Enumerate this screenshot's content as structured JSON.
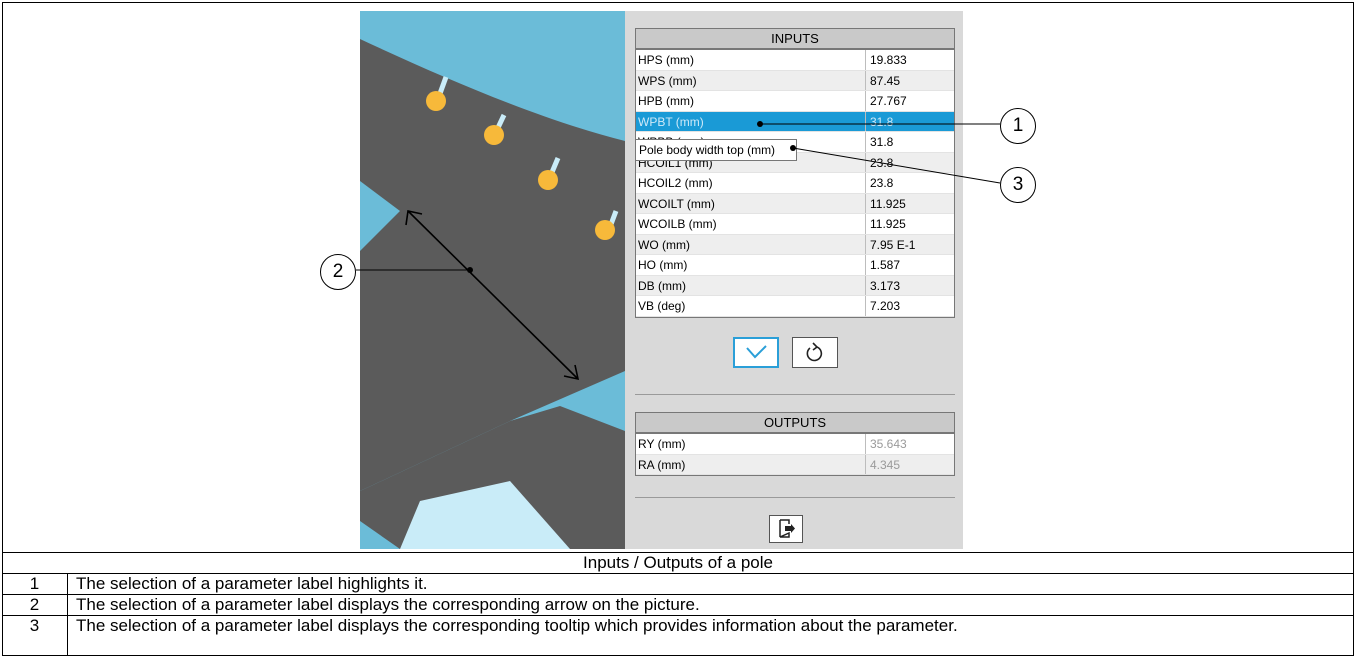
{
  "inputs": {
    "header": "INPUTS",
    "rows": [
      {
        "label": "HPS (mm)",
        "value": "19.833"
      },
      {
        "label": "WPS (mm)",
        "value": "87.45"
      },
      {
        "label": "HPB (mm)",
        "value": "27.767"
      },
      {
        "label": "WPBT (mm)",
        "value": "31.8"
      },
      {
        "label": "WPBB (mm)",
        "value": "31.8"
      },
      {
        "label": "HCOIL1 (mm)",
        "value": "23.8"
      },
      {
        "label": "HCOIL2 (mm)",
        "value": "23.8"
      },
      {
        "label": "WCOILT (mm)",
        "value": "11.925"
      },
      {
        "label": "WCOILB (mm)",
        "value": "11.925"
      },
      {
        "label": "WO (mm)",
        "value": "7.95 E-1"
      },
      {
        "label": "HO (mm)",
        "value": "1.587"
      },
      {
        "label": "DB (mm)",
        "value": "3.173"
      },
      {
        "label": "VB (deg)",
        "value": "7.203"
      }
    ],
    "selected_index": 3
  },
  "tooltip": "Pole body width top (mm)",
  "outputs": {
    "header": "OUTPUTS",
    "rows": [
      {
        "label": "RY (mm)",
        "value": "35.643"
      },
      {
        "label": "RA (mm)",
        "value": "4.345"
      }
    ]
  },
  "icons": {
    "validate": "checkmark-icon",
    "reset": "undo-arrow-icon",
    "export": "export-document-icon"
  },
  "callouts": [
    "1",
    "2",
    "3"
  ],
  "caption": "Inputs / Outputs of a pole",
  "notes": [
    {
      "num": "1",
      "text": "The selection of a parameter label highlights it."
    },
    {
      "num": "2",
      "text": "The selection of a parameter label displays the corresponding arrow on the picture."
    },
    {
      "num": "3",
      "text": "The selection of a parameter label displays the corresponding tooltip which provides information about the parameter."
    }
  ],
  "colors": {
    "background_blue": "#6bbcd8",
    "pole_gray": "#5b5b5b",
    "magnet_orange": "#f7b93a",
    "selection_blue": "#1a9ad6"
  }
}
